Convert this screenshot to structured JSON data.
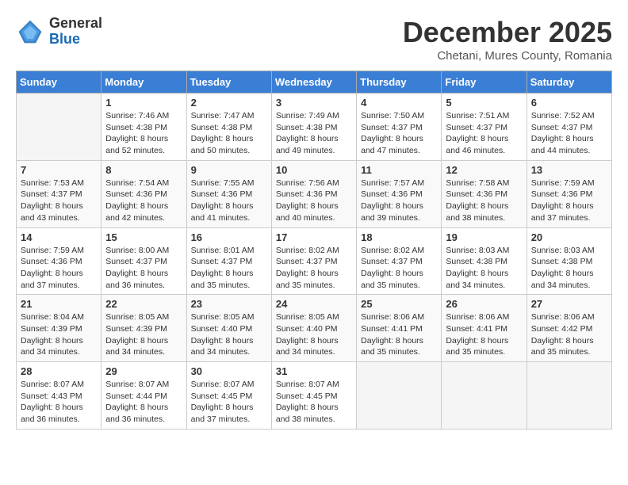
{
  "header": {
    "logo": {
      "general": "General",
      "blue": "Blue"
    },
    "month_title": "December 2025",
    "subtitle": "Chetani, Mures County, Romania"
  },
  "weekdays": [
    "Sunday",
    "Monday",
    "Tuesday",
    "Wednesday",
    "Thursday",
    "Friday",
    "Saturday"
  ],
  "weeks": [
    [
      {
        "day": null,
        "sunrise": null,
        "sunset": null,
        "daylight": null
      },
      {
        "day": "1",
        "sunrise": "Sunrise: 7:46 AM",
        "sunset": "Sunset: 4:38 PM",
        "daylight": "Daylight: 8 hours and 52 minutes."
      },
      {
        "day": "2",
        "sunrise": "Sunrise: 7:47 AM",
        "sunset": "Sunset: 4:38 PM",
        "daylight": "Daylight: 8 hours and 50 minutes."
      },
      {
        "day": "3",
        "sunrise": "Sunrise: 7:49 AM",
        "sunset": "Sunset: 4:38 PM",
        "daylight": "Daylight: 8 hours and 49 minutes."
      },
      {
        "day": "4",
        "sunrise": "Sunrise: 7:50 AM",
        "sunset": "Sunset: 4:37 PM",
        "daylight": "Daylight: 8 hours and 47 minutes."
      },
      {
        "day": "5",
        "sunrise": "Sunrise: 7:51 AM",
        "sunset": "Sunset: 4:37 PM",
        "daylight": "Daylight: 8 hours and 46 minutes."
      },
      {
        "day": "6",
        "sunrise": "Sunrise: 7:52 AM",
        "sunset": "Sunset: 4:37 PM",
        "daylight": "Daylight: 8 hours and 44 minutes."
      }
    ],
    [
      {
        "day": "7",
        "sunrise": "Sunrise: 7:53 AM",
        "sunset": "Sunset: 4:37 PM",
        "daylight": "Daylight: 8 hours and 43 minutes."
      },
      {
        "day": "8",
        "sunrise": "Sunrise: 7:54 AM",
        "sunset": "Sunset: 4:36 PM",
        "daylight": "Daylight: 8 hours and 42 minutes."
      },
      {
        "day": "9",
        "sunrise": "Sunrise: 7:55 AM",
        "sunset": "Sunset: 4:36 PM",
        "daylight": "Daylight: 8 hours and 41 minutes."
      },
      {
        "day": "10",
        "sunrise": "Sunrise: 7:56 AM",
        "sunset": "Sunset: 4:36 PM",
        "daylight": "Daylight: 8 hours and 40 minutes."
      },
      {
        "day": "11",
        "sunrise": "Sunrise: 7:57 AM",
        "sunset": "Sunset: 4:36 PM",
        "daylight": "Daylight: 8 hours and 39 minutes."
      },
      {
        "day": "12",
        "sunrise": "Sunrise: 7:58 AM",
        "sunset": "Sunset: 4:36 PM",
        "daylight": "Daylight: 8 hours and 38 minutes."
      },
      {
        "day": "13",
        "sunrise": "Sunrise: 7:59 AM",
        "sunset": "Sunset: 4:36 PM",
        "daylight": "Daylight: 8 hours and 37 minutes."
      }
    ],
    [
      {
        "day": "14",
        "sunrise": "Sunrise: 7:59 AM",
        "sunset": "Sunset: 4:36 PM",
        "daylight": "Daylight: 8 hours and 37 minutes."
      },
      {
        "day": "15",
        "sunrise": "Sunrise: 8:00 AM",
        "sunset": "Sunset: 4:37 PM",
        "daylight": "Daylight: 8 hours and 36 minutes."
      },
      {
        "day": "16",
        "sunrise": "Sunrise: 8:01 AM",
        "sunset": "Sunset: 4:37 PM",
        "daylight": "Daylight: 8 hours and 35 minutes."
      },
      {
        "day": "17",
        "sunrise": "Sunrise: 8:02 AM",
        "sunset": "Sunset: 4:37 PM",
        "daylight": "Daylight: 8 hours and 35 minutes."
      },
      {
        "day": "18",
        "sunrise": "Sunrise: 8:02 AM",
        "sunset": "Sunset: 4:37 PM",
        "daylight": "Daylight: 8 hours and 35 minutes."
      },
      {
        "day": "19",
        "sunrise": "Sunrise: 8:03 AM",
        "sunset": "Sunset: 4:38 PM",
        "daylight": "Daylight: 8 hours and 34 minutes."
      },
      {
        "day": "20",
        "sunrise": "Sunrise: 8:03 AM",
        "sunset": "Sunset: 4:38 PM",
        "daylight": "Daylight: 8 hours and 34 minutes."
      }
    ],
    [
      {
        "day": "21",
        "sunrise": "Sunrise: 8:04 AM",
        "sunset": "Sunset: 4:39 PM",
        "daylight": "Daylight: 8 hours and 34 minutes."
      },
      {
        "day": "22",
        "sunrise": "Sunrise: 8:05 AM",
        "sunset": "Sunset: 4:39 PM",
        "daylight": "Daylight: 8 hours and 34 minutes."
      },
      {
        "day": "23",
        "sunrise": "Sunrise: 8:05 AM",
        "sunset": "Sunset: 4:40 PM",
        "daylight": "Daylight: 8 hours and 34 minutes."
      },
      {
        "day": "24",
        "sunrise": "Sunrise: 8:05 AM",
        "sunset": "Sunset: 4:40 PM",
        "daylight": "Daylight: 8 hours and 34 minutes."
      },
      {
        "day": "25",
        "sunrise": "Sunrise: 8:06 AM",
        "sunset": "Sunset: 4:41 PM",
        "daylight": "Daylight: 8 hours and 35 minutes."
      },
      {
        "day": "26",
        "sunrise": "Sunrise: 8:06 AM",
        "sunset": "Sunset: 4:41 PM",
        "daylight": "Daylight: 8 hours and 35 minutes."
      },
      {
        "day": "27",
        "sunrise": "Sunrise: 8:06 AM",
        "sunset": "Sunset: 4:42 PM",
        "daylight": "Daylight: 8 hours and 35 minutes."
      }
    ],
    [
      {
        "day": "28",
        "sunrise": "Sunrise: 8:07 AM",
        "sunset": "Sunset: 4:43 PM",
        "daylight": "Daylight: 8 hours and 36 minutes."
      },
      {
        "day": "29",
        "sunrise": "Sunrise: 8:07 AM",
        "sunset": "Sunset: 4:44 PM",
        "daylight": "Daylight: 8 hours and 36 minutes."
      },
      {
        "day": "30",
        "sunrise": "Sunrise: 8:07 AM",
        "sunset": "Sunset: 4:45 PM",
        "daylight": "Daylight: 8 hours and 37 minutes."
      },
      {
        "day": "31",
        "sunrise": "Sunrise: 8:07 AM",
        "sunset": "Sunset: 4:45 PM",
        "daylight": "Daylight: 8 hours and 38 minutes."
      },
      {
        "day": null,
        "sunrise": null,
        "sunset": null,
        "daylight": null
      },
      {
        "day": null,
        "sunrise": null,
        "sunset": null,
        "daylight": null
      },
      {
        "day": null,
        "sunrise": null,
        "sunset": null,
        "daylight": null
      }
    ]
  ]
}
